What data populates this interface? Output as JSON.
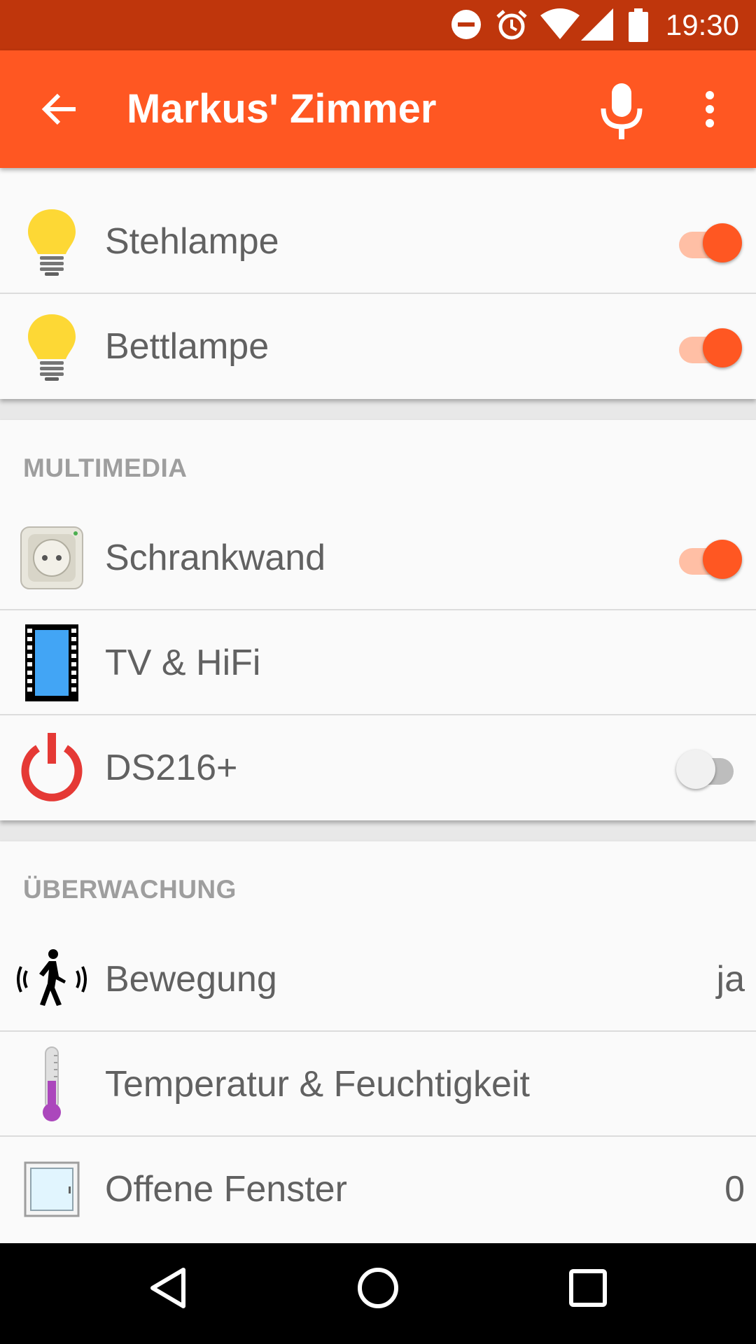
{
  "status_bar": {
    "time": "19:30",
    "icons": [
      "do-not-disturb-icon",
      "alarm-icon",
      "wifi-icon",
      "cell-signal-icon",
      "battery-icon"
    ]
  },
  "app_bar": {
    "title": "Markus' Zimmer",
    "icons": [
      "back-arrow-icon",
      "microphone-icon",
      "more-vert-icon"
    ],
    "color": "#ff5722"
  },
  "groups": [
    {
      "header": "",
      "items": [
        {
          "label": "Stehlampe",
          "icon": "light-bulb-icon",
          "switch_on": true
        },
        {
          "label": "Bettlampe",
          "icon": "light-bulb-icon",
          "switch_on": true
        }
      ]
    },
    {
      "header": "MULTIMEDIA",
      "items": [
        {
          "label": "Schrankwand",
          "icon": "power-socket-icon",
          "switch_on": true
        },
        {
          "label": "TV & HiFi",
          "icon": "film-strip-icon"
        },
        {
          "label": "DS216+",
          "icon": "power-icon",
          "switch_on": false
        }
      ]
    },
    {
      "header": "ÜBERWACHUNG",
      "items": [
        {
          "label": "Bewegung",
          "icon": "motion-sensor-icon",
          "value": "ja"
        },
        {
          "label": "Temperatur & Feuchtigkeit",
          "icon": "thermometer-icon"
        },
        {
          "label": "Offene Fenster",
          "icon": "window-icon",
          "value": "0"
        }
      ]
    }
  ],
  "nav_bar": {
    "icons": [
      "back-triangle-icon",
      "home-circle-icon",
      "recents-square-icon"
    ]
  },
  "colors": {
    "status_bar": "#bf360c",
    "accent": "#ff5722",
    "bulb": "#fdd835",
    "power": "#e53935",
    "film": "#42a5f5",
    "thermo": "#ab47bc"
  }
}
